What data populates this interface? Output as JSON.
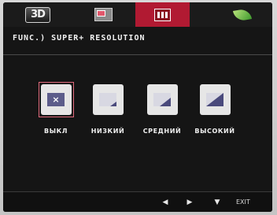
{
  "tabs": [
    {
      "id": "3d",
      "icon": "3d-mode-icon",
      "label": "3D"
    },
    {
      "id": "pip",
      "icon": "picture-in-picture-icon"
    },
    {
      "id": "picture",
      "icon": "picture-settings-icon",
      "active": true
    },
    {
      "id": "eco",
      "icon": "eco-leaf-icon"
    }
  ],
  "header": {
    "text": "FUNC.) SUPER+ RESOLUTION"
  },
  "options": [
    {
      "label": "ВЫКЛ",
      "glyph": "×",
      "selected": true
    },
    {
      "label": "НИЗКИЙ",
      "level": 0.35
    },
    {
      "label": "СРЕДНИЙ",
      "level": 0.65
    },
    {
      "label": "ВЫСОКИЙ",
      "level": 1.0
    }
  ],
  "bottom": {
    "left_arrow": "◀",
    "right_arrow": "▶",
    "down_arrow": "▼",
    "exit": "EXIT"
  },
  "colors": {
    "active_tab": "#b11a32",
    "selection_frame": "#e06a7c"
  }
}
